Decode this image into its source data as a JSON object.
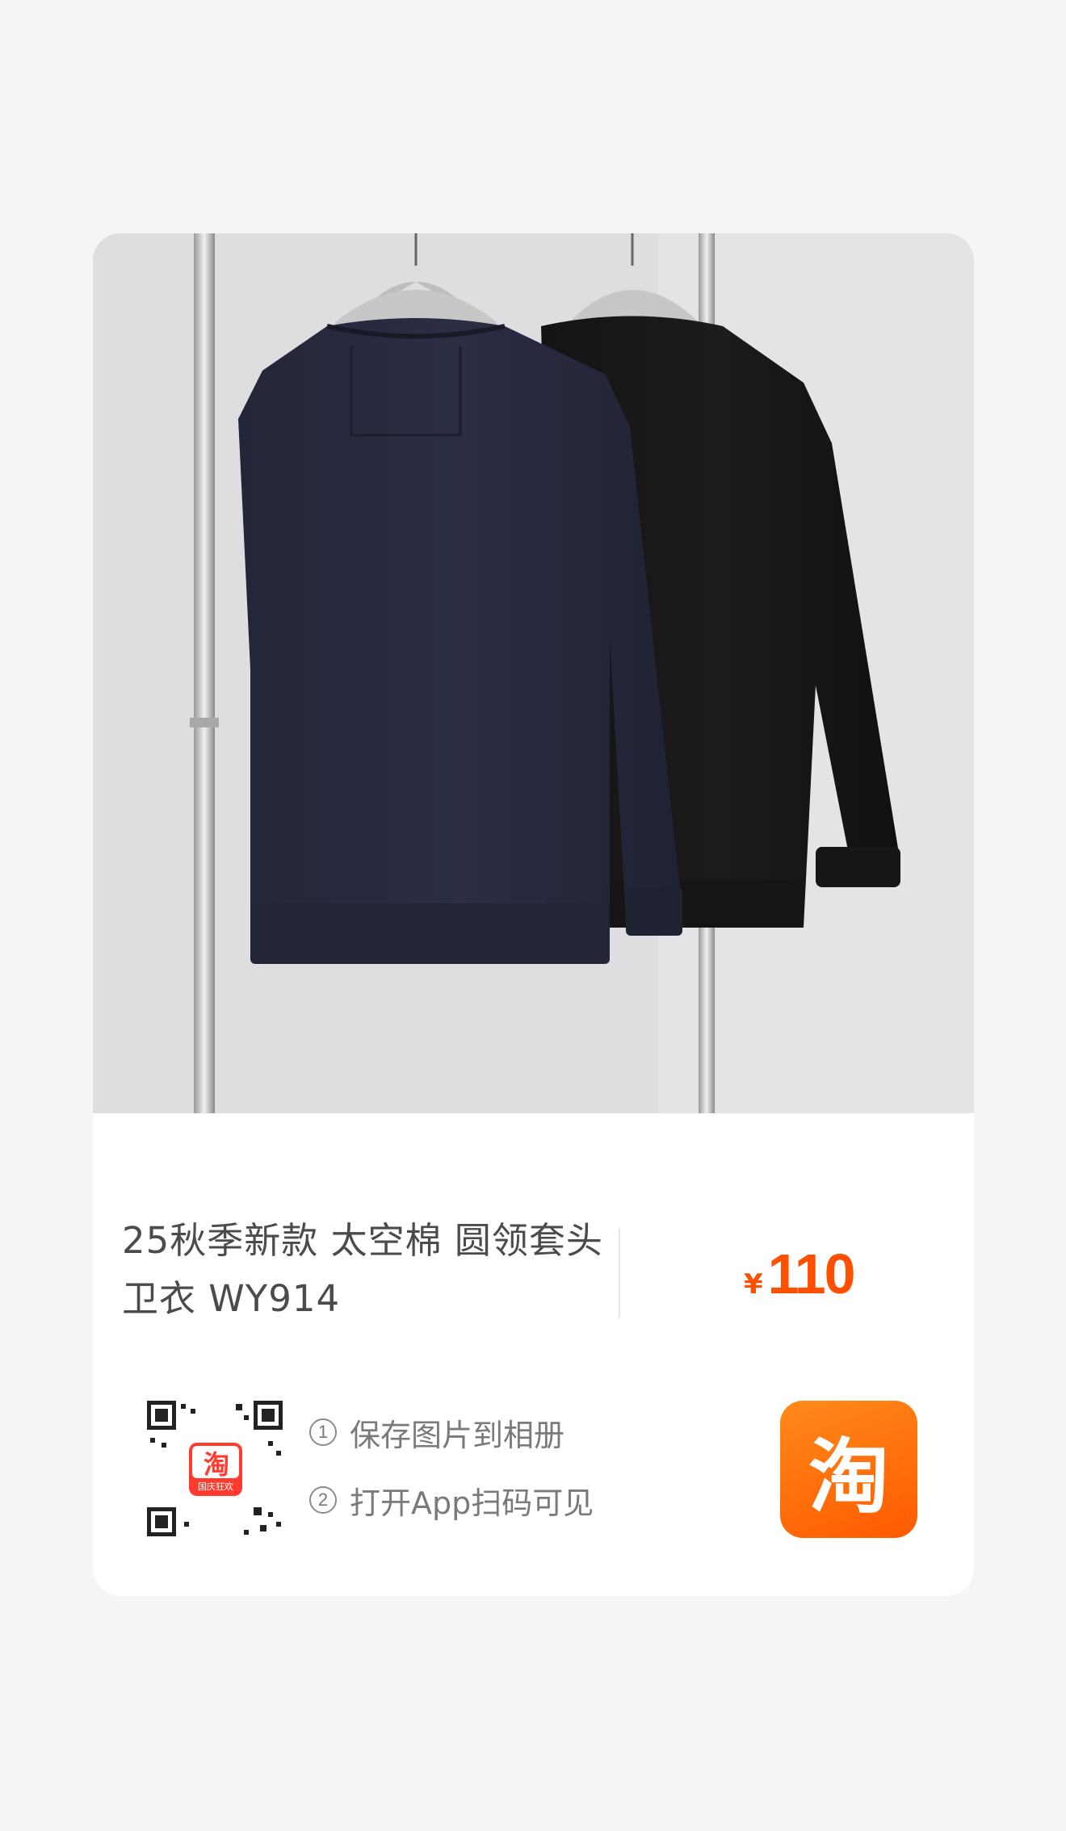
{
  "product": {
    "title": "25秋季新款 太空棉 圆领套头卫衣 WY914",
    "currency_symbol": "¥",
    "price": "110"
  },
  "instructions": [
    {
      "num": "1",
      "text": "保存图片到相册"
    },
    {
      "num": "2",
      "text": "打开App扫码可见"
    }
  ],
  "qr": {
    "badge_glyph": "淘",
    "badge_caption": "国庆狂欢"
  },
  "app_icon": {
    "glyph": "淘"
  },
  "colors": {
    "accent": "#ff5000",
    "card_bg": "#ffffff",
    "page_bg": "#f5f5f5"
  }
}
